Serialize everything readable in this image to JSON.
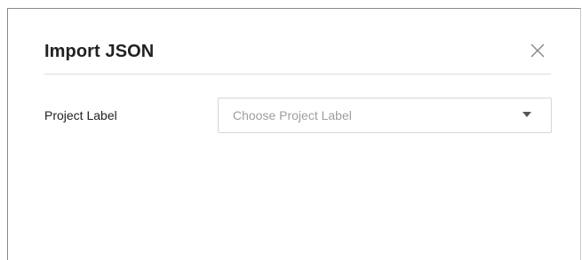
{
  "dialog": {
    "title": "Import JSON",
    "close_icon": "close-icon"
  },
  "form": {
    "project_label": {
      "label": "Project Label",
      "placeholder": "Choose Project Label",
      "arrow_icon": "caret-down-icon"
    }
  },
  "colors": {
    "title": "#222222",
    "placeholder": "#9e9e9e",
    "border": "#d6d6d6",
    "divider": "#dcdcdc",
    "close_icon": "#888888",
    "arrow": "#555555"
  }
}
